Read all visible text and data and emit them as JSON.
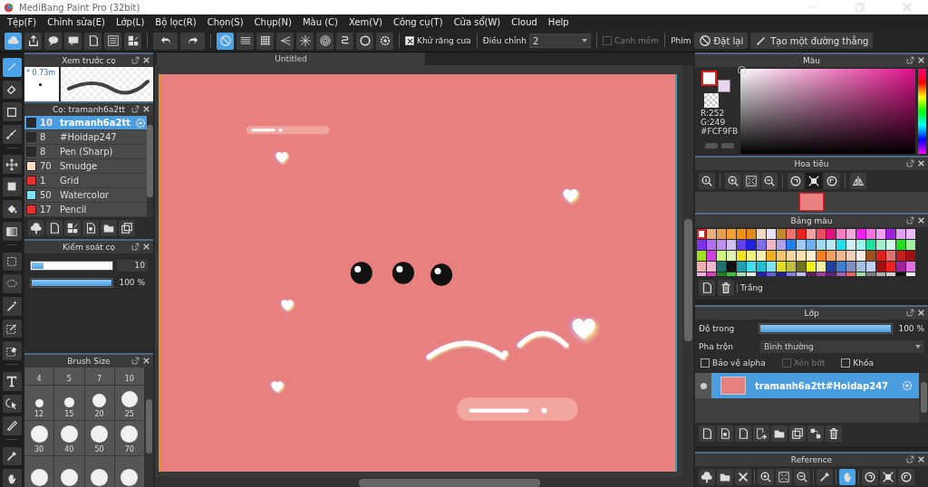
{
  "window": {
    "title": "MediBang Paint Pro (32bit)"
  },
  "menu": [
    "Tệp(F)",
    "Chỉnh sửa(E)",
    "Lớp(L)",
    "Bộ lọc(R)",
    "Chọn(S)",
    "Chụp(N)",
    "Màu (C)",
    "Xem(V)",
    "Công cụ(T)",
    "Cửa sổ(W)",
    "Cloud",
    "Help"
  ],
  "toolbar": {
    "snaps": [
      {
        "selected": true
      },
      {
        "selected": false
      },
      {
        "selected": false
      },
      {
        "selected": false
      },
      {
        "selected": false
      },
      {
        "selected": false
      },
      {
        "selected": false
      },
      {
        "selected": false
      },
      {
        "selected": false
      }
    ],
    "antialias": {
      "label": "Khử răng cưa",
      "checked": true
    },
    "adjust": {
      "label": "Điều chỉnh",
      "value": "2"
    },
    "soft_edge": {
      "label": "Cạnh mềm",
      "checked": false,
      "disabled": true
    },
    "key_label": "Phím",
    "buttons": [
      "Đặt lại",
      "Tạo một đường thẳng"
    ]
  },
  "tools": [
    {
      "selected": true
    },
    {
      "selected": false
    },
    {
      "selected": false
    },
    {
      "selected": false
    },
    {
      "selected": false
    },
    {
      "selected": false
    },
    {
      "selected": false
    },
    {
      "selected": false
    },
    {
      "selected": false
    },
    {
      "selected": false
    },
    {
      "selected": false
    },
    {
      "selected": false
    },
    {
      "selected": false
    },
    {
      "selected": false
    },
    {
      "selected": false
    },
    {
      "selected": false
    },
    {
      "selected": false
    },
    {
      "selected": false
    }
  ],
  "brush_preview": {
    "title": "Xem trước cọ",
    "size": "* 0.73m"
  },
  "brushes": {
    "title": "Cọ: tramanh6a2tt",
    "items": [
      {
        "size": "10",
        "name": "tramanh6a2tt",
        "color": "#2a2a2a",
        "selected": true
      },
      {
        "size": "8",
        "name": "#Hoidap247",
        "color": "#2a2a2a",
        "selected": false
      },
      {
        "size": "8",
        "name": "Pen (Sharp)",
        "color": "#2a2a2a",
        "selected": false
      },
      {
        "size": "70",
        "name": "Smudge",
        "color": "#f8dcc8",
        "selected": false
      },
      {
        "size": "1",
        "name": "Grid",
        "color": "#e83030",
        "selected": false
      },
      {
        "size": "50",
        "name": "Watercolor",
        "color": "#80e0f8",
        "selected": false
      },
      {
        "size": "17",
        "name": "Pencil",
        "color": "#e83030",
        "selected": false
      }
    ]
  },
  "brush_control": {
    "title": "Kiểm soát cọ",
    "sliders": [
      {
        "level": 0.15,
        "reading": "10"
      },
      {
        "level": 1,
        "reading": "100 %"
      }
    ]
  },
  "brush_size": {
    "title": "Brush Size",
    "sizes": [
      "4",
      "5",
      "7",
      "10",
      "12",
      "15",
      "20",
      "25",
      "30",
      "40",
      "50",
      "70"
    ]
  },
  "canvas": {
    "tab": "Untitled"
  },
  "color": {
    "title": "Màu",
    "foreground": {
      "color": "#fcf9fb"
    },
    "background": {
      "color": "#e6d6f2"
    },
    "values": [
      "R:252",
      "G:249"
    ],
    "hex": "#FCF9FB"
  },
  "navigator": {
    "title": "Hoa tiêu",
    "buttons": [
      {
        "selected": false
      },
      {
        "selected": false
      },
      {
        "selected": false
      },
      {
        "selected": false
      },
      {
        "selected": false
      },
      {
        "selected": true
      },
      {
        "selected": false
      },
      {
        "selected": false
      }
    ]
  },
  "palette": {
    "title": "Bảng màu",
    "name": "Trắng",
    "rows": [
      [
        {
          "color": "#ffffff",
          "selected": true
        },
        {
          "color": "#e8b080",
          "selected": false
        },
        {
          "color": "#e8a050",
          "selected": false
        },
        {
          "color": "#f0a030",
          "selected": false
        },
        {
          "color": "#f09010",
          "selected": false
        },
        {
          "color": "#e08820",
          "selected": false
        },
        {
          "color": "#f0d8c0",
          "selected": false
        },
        {
          "color": "#e8e0f8",
          "selected": false
        },
        {
          "color": "#c08828",
          "selected": false
        },
        {
          "color": "#f07070",
          "selected": false
        },
        {
          "color": "#e82020",
          "selected": false
        },
        {
          "color": "#f0a0a0",
          "selected": false
        },
        {
          "color": "#e85060",
          "selected": false
        },
        {
          "color": "#e01080",
          "selected": false
        },
        {
          "color": "#f080c0",
          "selected": false
        },
        {
          "color": "#f0a8d8",
          "selected": false
        },
        {
          "color": "#f020f0",
          "selected": false
        },
        {
          "color": "#f070e0",
          "selected": false
        },
        {
          "color": "#f0a0f0",
          "selected": false
        },
        {
          "color": "#a020e0",
          "selected": false
        },
        {
          "color": "#e0a0f0",
          "selected": false
        },
        {
          "color": "#e8b8f8",
          "selected": false
        }
      ],
      [
        {
          "color": "#8030f0",
          "selected": false
        },
        {
          "color": "#b070f0",
          "selected": false
        },
        {
          "color": "#c090f0",
          "selected": false
        },
        {
          "color": "#d0c0f8",
          "selected": false
        },
        {
          "color": "#6040f0",
          "selected": false
        },
        {
          "color": "#2020e0",
          "selected": false
        },
        {
          "color": "#8070f0",
          "selected": false
        },
        {
          "color": "#f0b8c8",
          "selected": false
        },
        {
          "color": "#b0a0f0",
          "selected": false
        },
        {
          "color": "#2080f0",
          "selected": false
        },
        {
          "color": "#a0c8f0",
          "selected": false
        },
        {
          "color": "#70b0f0",
          "selected": false
        },
        {
          "color": "#a0d8f0",
          "selected": false
        },
        {
          "color": "#b8e8f8",
          "selected": false
        },
        {
          "color": "#20e0f0",
          "selected": false
        },
        {
          "color": "#d0f0f8",
          "selected": false
        },
        {
          "color": "#a0f0f0",
          "selected": false
        },
        {
          "color": "#20e0a0",
          "selected": false
        },
        {
          "color": "#a0f0d0",
          "selected": false
        },
        {
          "color": "#d0f8e8",
          "selected": false
        },
        {
          "color": "#20e020",
          "selected": false
        },
        {
          "color": "#a0f0a0",
          "selected": false
        }
      ],
      [
        {
          "color": "#a0e020",
          "selected": false
        },
        {
          "color": "#d040e0",
          "selected": false
        },
        {
          "color": "#d0f080",
          "selected": false
        },
        {
          "color": "#e0f0b0",
          "selected": false
        },
        {
          "color": "#f0e020",
          "selected": false
        },
        {
          "color": "#f0f080",
          "selected": false
        },
        {
          "color": "#f8f0b0",
          "selected": false
        },
        {
          "color": "#f0b020",
          "selected": false
        },
        {
          "color": "#f0c870",
          "selected": false
        },
        {
          "color": "#f0d8a0",
          "selected": false
        },
        {
          "color": "#f8e0b0",
          "selected": false
        },
        {
          "color": "#f8f0d0",
          "selected": false
        },
        {
          "color": "#f08020",
          "selected": false
        },
        {
          "color": "#f0a060",
          "selected": false
        },
        {
          "color": "#f0b890",
          "selected": false
        },
        {
          "color": "#f0d0b8",
          "selected": false
        },
        {
          "color": "#f8e8e0",
          "selected": false
        },
        {
          "color": "#a05020",
          "selected": false
        },
        {
          "color": "#e02020",
          "selected": false
        },
        {
          "color": "#e07070",
          "selected": false
        },
        {
          "color": "#c02020",
          "selected": false
        },
        {
          "color": "#a01010",
          "selected": false
        }
      ],
      [
        {
          "color": "#f0b0b0",
          "selected": false
        },
        {
          "color": "#f0b8d0",
          "selected": false
        },
        {
          "color": "#207070",
          "selected": false
        },
        {
          "color": "#101010",
          "selected": false
        },
        {
          "color": "#20a0b0",
          "selected": false
        },
        {
          "color": "#40e0f0",
          "selected": false
        },
        {
          "color": "#20c0d0",
          "selected": false
        },
        {
          "color": "#80e0f0",
          "selected": false
        },
        {
          "color": "#e0e020",
          "selected": false
        },
        {
          "color": "#c0c040",
          "selected": false
        },
        {
          "color": "#707020",
          "selected": false
        },
        {
          "color": "#f0f020",
          "selected": false
        },
        {
          "color": "#f0f0a0",
          "selected": false
        },
        {
          "color": "#2040a0",
          "selected": false
        },
        {
          "color": "#4080d0",
          "selected": false
        },
        {
          "color": "#8090c0",
          "selected": false
        },
        {
          "color": "#a0c0e0",
          "selected": false
        },
        {
          "color": "#c0d0f0",
          "selected": false
        },
        {
          "color": "#a01010",
          "selected": false
        },
        {
          "color": "#f02020",
          "selected": false
        },
        {
          "color": "#a020a0",
          "selected": false
        },
        {
          "color": "#e070e0",
          "selected": false
        }
      ],
      [
        {
          "color": "#f0b0e0",
          "selected": false
        },
        {
          "color": "#e040c0",
          "selected": false
        },
        {
          "color": "#208020",
          "selected": false
        },
        {
          "color": "#40c040",
          "selected": false
        },
        {
          "color": "#b0e0b0",
          "selected": false
        },
        {
          "color": "#e0f0e0",
          "selected": false
        },
        {
          "color": "#2020c0",
          "selected": false
        },
        {
          "color": "#6060e0",
          "selected": false
        },
        {
          "color": "#2020a0",
          "selected": false
        },
        {
          "color": "#8080e0",
          "selected": false
        },
        {
          "color": "#c0c0f0",
          "selected": false
        },
        {
          "color": "#602060",
          "selected": false
        },
        {
          "color": "#a040a0",
          "selected": false
        },
        {
          "color": "#602080",
          "selected": false
        },
        {
          "color": "#a060c0",
          "selected": false
        },
        {
          "color": "#f06060",
          "selected": false
        },
        {
          "color": "#a0e0a0",
          "selected": false
        },
        {
          "color": "#808080",
          "selected": false
        },
        {
          "color": "#b0b0b0",
          "selected": false
        },
        {
          "color": "#d0d0d0",
          "selected": false
        },
        {
          "color": "#101010",
          "selected": false
        },
        {
          "color": "#f0f0f0",
          "selected": false
        }
      ]
    ]
  },
  "layers": {
    "title": "Lớp",
    "opacity": {
      "label": "Độ trong",
      "level": 1,
      "reading": "100 %"
    },
    "blend": {
      "label": "Pha trộn",
      "value": "Bình thường"
    },
    "options": [
      {
        "label": "Bảo vệ alpha",
        "checked": false,
        "disabled": false
      },
      {
        "label": "Xén bớt",
        "checked": false,
        "disabled": true
      },
      {
        "label": "Khóa",
        "checked": false,
        "disabled": false
      }
    ],
    "items": [
      {
        "name": "tramanh6a2tt#Hoidap247",
        "selected": true
      }
    ]
  },
  "reference": {
    "title": "Reference",
    "buttons": [
      {
        "selected": false
      },
      {
        "selected": false
      },
      {
        "selected": false
      },
      {
        "selected": false
      },
      {
        "selected": false
      },
      {
        "selected": false
      },
      {
        "selected": false
      },
      {
        "selected": true
      },
      {
        "selected": false
      },
      {
        "selected": false
      },
      {
        "selected": false
      }
    ]
  }
}
